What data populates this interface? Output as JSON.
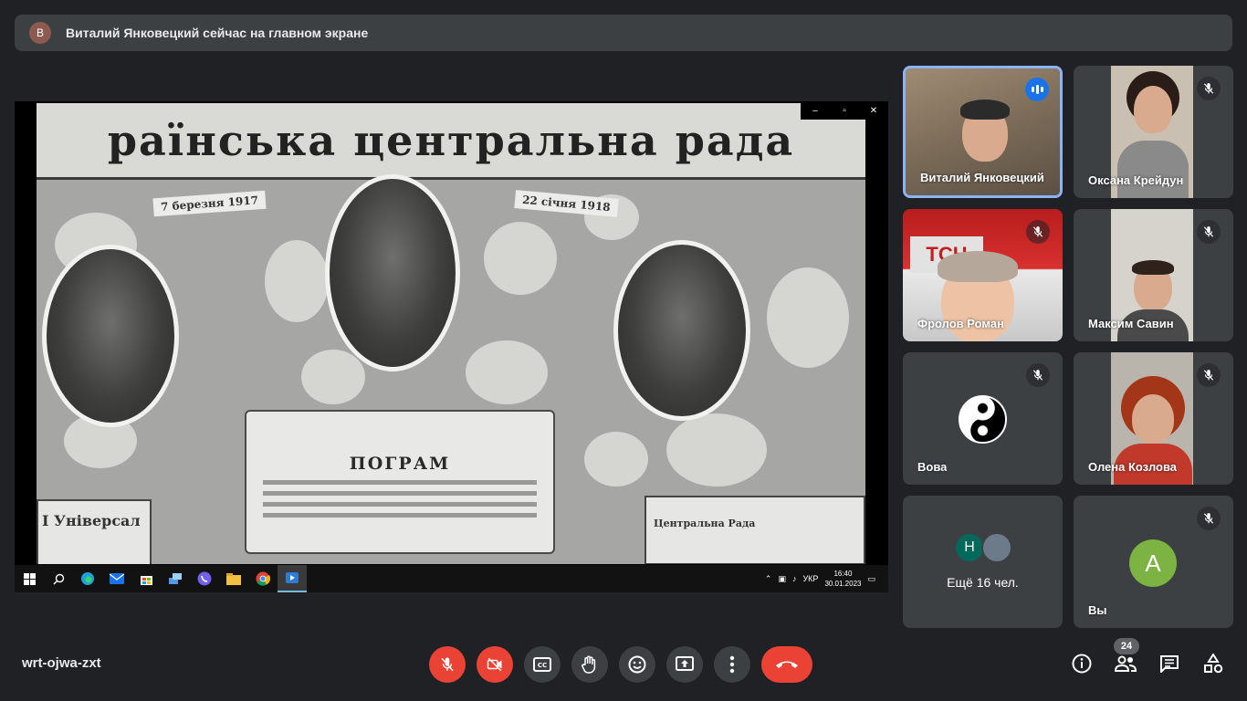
{
  "banner": {
    "avatar_letter": "В",
    "text": "Виталий Янковецкий сейчас на главном экране"
  },
  "presentation": {
    "slide_title": "раїнська центральна рада",
    "ribbon_left": "7 березня 1917",
    "ribbon_right": "22 січня 1918",
    "program_title": "ПОГРАМ",
    "side_doc_left": "І Універсал",
    "side_doc_right": "Центральна Рада",
    "window_controls": [
      "–",
      "▫",
      "✕"
    ]
  },
  "taskbar": {
    "language": "УКР",
    "time": "16:40",
    "date": "30.01.2023"
  },
  "tiles": [
    {
      "name": "Виталий Янковецкий",
      "state": "speaking"
    },
    {
      "name": "Оксана Крейдун",
      "state": "muted"
    },
    {
      "name": "Фролов Роман",
      "state": "muted"
    },
    {
      "name": "Максим Савин",
      "state": "muted"
    },
    {
      "name": "Вова",
      "state": "muted"
    },
    {
      "name": "Олена Козлова",
      "state": "muted"
    },
    {
      "name": "Ещё 16 чел.",
      "avatar_letter": "Н"
    },
    {
      "name": "Вы",
      "avatar_letter": "A",
      "state": "muted"
    }
  ],
  "meeting": {
    "code": "wrt-ojwa-zxt",
    "participant_count": "24"
  },
  "colors": {
    "background": "#202124",
    "tile": "#3c4043",
    "red": "#ea4335",
    "active_border": "#8ab4f8",
    "speaking": "#1a73e8"
  }
}
